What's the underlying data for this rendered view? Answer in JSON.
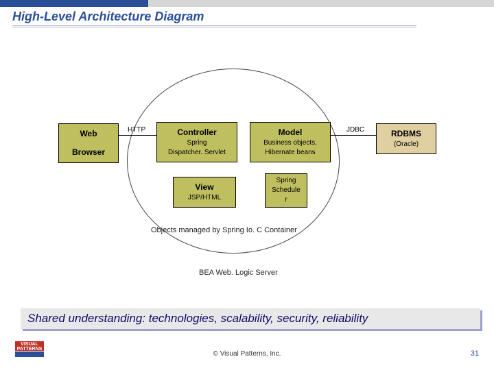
{
  "title": "High-Level Architecture Diagram",
  "labels": {
    "http": "HTTP",
    "jdbc": "JDBC"
  },
  "boxes": {
    "web": {
      "head": "Web",
      "sub": "Browser"
    },
    "controller": {
      "head": "Controller",
      "sub1": "Spring",
      "sub2": "Dispatcher. Servlet"
    },
    "model": {
      "head": "Model",
      "sub1": "Business objects,",
      "sub2": "Hibernate beans"
    },
    "view": {
      "head": "View",
      "sub1": "JSP/HTML"
    },
    "scheduler": {
      "head": "Spring",
      "sub1": "Schedule",
      "sub2": "r"
    },
    "rdbms": {
      "head": "RDBMS",
      "sub1": "(Oracle)"
    }
  },
  "captions": {
    "container": "Objects managed by Spring Io. C Container",
    "server": "BEA Web. Logic Server"
  },
  "banner": "Shared understanding: technologies, scalability, security, reliability",
  "copyright": "© Visual Patterns, Inc.",
  "page": "31",
  "logo": {
    "line1": "VISUAL",
    "line2": "PATTERNS"
  }
}
